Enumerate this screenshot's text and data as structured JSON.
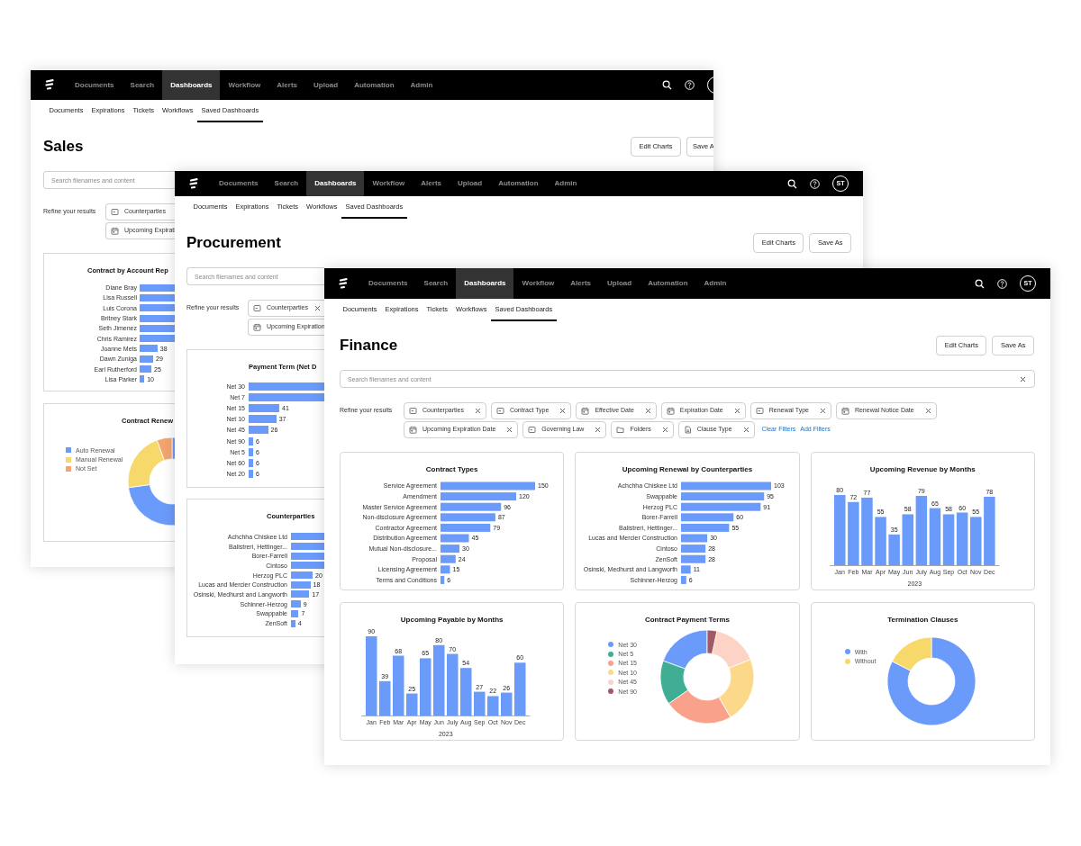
{
  "windows": [
    {
      "nav": [
        {
          "label": "Documents",
          "selected": false
        },
        {
          "label": "Search",
          "selected": false
        },
        {
          "label": "Dashboards",
          "selected": true
        },
        {
          "label": "Workflow",
          "selected": false
        },
        {
          "label": "Alerts",
          "selected": false
        },
        {
          "label": "Upload",
          "selected": false
        },
        {
          "label": "Automation",
          "selected": false
        },
        {
          "label": "Admin",
          "selected": false
        }
      ],
      "subnav": [
        {
          "label": "Documents",
          "selected": false
        },
        {
          "label": "Expirations",
          "selected": false
        },
        {
          "label": "Tickets",
          "selected": false
        },
        {
          "label": "Workflows",
          "selected": false
        },
        {
          "label": "Saved Dashboards",
          "selected": true
        }
      ],
      "title": "Sales",
      "buttons": [
        "Edit Charts",
        "Save A"
      ],
      "search": {
        "placeholder": "Search filenames and content",
        "clearable": false
      },
      "refine_label": "Refine your results",
      "filters": [
        {
          "label": "Counterparties",
          "kind": "select",
          "removable": false
        },
        {
          "label": "Upcoming Expirati",
          "kind": "date",
          "removable": false
        }
      ],
      "panels": [
        {
          "kind": "bars",
          "title": "Contract by Account Rep",
          "rows": [
            {
              "label": "Diane Bray"
            },
            {
              "label": "Lisa Russell"
            },
            {
              "label": "Luis Corona"
            },
            {
              "label": "Britney Stark"
            },
            {
              "label": "Seth Jimenez"
            },
            {
              "label": "Chris Ramirez"
            },
            {
              "label": "Joanne Mets",
              "value": "38"
            },
            {
              "label": "Dawn Zuniga",
              "value": "29"
            },
            {
              "label": "Earl Rutherford",
              "value": "25"
            },
            {
              "label": "Lisa Parker",
              "value": "10"
            }
          ]
        },
        {
          "kind": "donut",
          "title": "Contract Renew",
          "legend": [
            {
              "label": "Auto Renewal",
              "color": "#6b9bfa"
            },
            {
              "label": "Manual Renewal",
              "color": "#f7d96b"
            },
            {
              "label": "Not Set",
              "color": "#f5a470"
            }
          ]
        }
      ]
    },
    {
      "nav": [
        {
          "label": "Documents",
          "selected": false
        },
        {
          "label": "Search",
          "selected": false
        },
        {
          "label": "Dashboards",
          "selected": true
        },
        {
          "label": "Workflow",
          "selected": false
        },
        {
          "label": "Alerts",
          "selected": false
        },
        {
          "label": "Upload",
          "selected": false
        },
        {
          "label": "Automation",
          "selected": false
        },
        {
          "label": "Admin",
          "selected": false
        }
      ],
      "avatar": "ST",
      "subnav": [
        {
          "label": "Documents",
          "selected": false
        },
        {
          "label": "Expirations",
          "selected": false
        },
        {
          "label": "Tickets",
          "selected": false
        },
        {
          "label": "Workflows",
          "selected": false
        },
        {
          "label": "Saved Dashboards",
          "selected": true
        }
      ],
      "title": "Procurement",
      "buttons": [
        "Edit Charts",
        "Save As"
      ],
      "search": {
        "placeholder": "Search filenames and content",
        "clearable": false
      },
      "refine_label": "Refine your results",
      "filters": [
        {
          "label": "Counterparties",
          "kind": "select",
          "removable": true
        },
        {
          "label": "Upcoming Expiration",
          "kind": "date",
          "removable": false
        }
      ],
      "panels": [
        {
          "kind": "bars",
          "title": "Payment Term (Net D",
          "rows": [
            {
              "label": "Net 30"
            },
            {
              "label": "Net 7"
            },
            {
              "label": "Net 15",
              "value": "41"
            },
            {
              "label": "Net 10",
              "value": "37"
            },
            {
              "label": "Net 45",
              "value": "26"
            },
            {
              "label": "Net 90",
              "value": "6"
            },
            {
              "label": "Net 5",
              "value": "6"
            },
            {
              "label": "Net 60",
              "value": "6"
            },
            {
              "label": "Net 20",
              "value": "6"
            }
          ]
        },
        {
          "kind": "bars",
          "title": "Counterparties",
          "rows": [
            {
              "label": "Achchha Chiskee Ltd"
            },
            {
              "label": "Balistreri, Hettinger..."
            },
            {
              "label": "Borer-Farrell"
            },
            {
              "label": "Cintoso"
            },
            {
              "label": "Herzog PLC",
              "value": "20"
            },
            {
              "label": "Lucas and Mercier Construction",
              "value": "18"
            },
            {
              "label": "Osinski, Medhurst and Langworth",
              "value": "17"
            },
            {
              "label": "Schinner-Herzog",
              "value": "9"
            },
            {
              "label": "Swappable",
              "value": "7"
            },
            {
              "label": "ZenSoft",
              "value": "4"
            }
          ]
        }
      ]
    },
    {
      "nav": [
        {
          "label": "Documents",
          "selected": false
        },
        {
          "label": "Search",
          "selected": false
        },
        {
          "label": "Dashboards",
          "selected": true
        },
        {
          "label": "Workflow",
          "selected": false
        },
        {
          "label": "Alerts",
          "selected": false
        },
        {
          "label": "Upload",
          "selected": false
        },
        {
          "label": "Automation",
          "selected": false
        },
        {
          "label": "Admin",
          "selected": false
        }
      ],
      "avatar": "ST",
      "subnav": [
        {
          "label": "Documents",
          "selected": false
        },
        {
          "label": "Expirations",
          "selected": false
        },
        {
          "label": "Tickets",
          "selected": false
        },
        {
          "label": "Workflows",
          "selected": false
        },
        {
          "label": "Saved Dashboards",
          "selected": true
        }
      ],
      "title": "Finance",
      "buttons": [
        "Edit Charts",
        "Save As"
      ],
      "search": {
        "placeholder": "Search filenames and content",
        "clearable": true
      },
      "refine_label": "Refine your results",
      "filters": [
        {
          "label": "Counterparties",
          "kind": "select",
          "removable": true
        },
        {
          "label": "Contract Type",
          "kind": "select",
          "removable": true
        },
        {
          "label": "Effective Date",
          "kind": "date",
          "removable": true
        },
        {
          "label": "Expiration Date",
          "kind": "date",
          "removable": true
        },
        {
          "label": "Renewal Type",
          "kind": "select",
          "removable": true
        },
        {
          "label": "Renewal Notice Date",
          "kind": "date",
          "removable": true
        },
        {
          "label": "Upcoming Expiration Date",
          "kind": "date",
          "removable": true
        },
        {
          "label": "Governing Law",
          "kind": "select",
          "removable": true
        },
        {
          "label": "Folders",
          "kind": "folder",
          "removable": true
        },
        {
          "label": "Clause Type",
          "kind": "file",
          "removable": true
        }
      ],
      "links": [
        "Clear Filters",
        "Add Filters"
      ],
      "panels": [
        {
          "kind": "chart",
          "title": "Contract Types",
          "chart_data": {
            "type": "bar",
            "orientation": "horizontal",
            "categories": [
              "Service Agreement",
              "Amendment",
              "Master Service Agreement",
              "Non-disclosure Agreement",
              "Contractor Agreement",
              "Distribution Agreement",
              "Mutual Non-disclosure...",
              "Proposal",
              "Licensing Agreement",
              "Terms and Conditions"
            ],
            "values": [
              150,
              120,
              96,
              87,
              79,
              45,
              30,
              24,
              15,
              6
            ],
            "data_labels": true
          }
        },
        {
          "kind": "chart",
          "title": "Upcoming Renewal by Counterparties",
          "chart_data": {
            "type": "bar",
            "orientation": "horizontal",
            "categories": [
              "Achchha Chiskee Ltd",
              "Swappable",
              "Herzog PLC",
              "Borer-Farrell",
              "Balistreri, Hettinger...",
              "Lucas and Mercier Construction",
              "Cintoso",
              "ZenSoft",
              "Osinski, Medhurst and Langworth",
              "Schinner-Herzog"
            ],
            "values": [
              103,
              95,
              91,
              60,
              55,
              30,
              28,
              28,
              11,
              6
            ],
            "data_labels": true
          }
        },
        {
          "kind": "chart",
          "title": "Upcoming Revenue by Months",
          "chart_data": {
            "type": "bar",
            "orientation": "vertical",
            "xlabel": "2023",
            "categories": [
              "Jan",
              "Feb",
              "Mar",
              "Apr",
              "May",
              "Jun",
              "July",
              "Aug",
              "Sep",
              "Oct",
              "Nov",
              "Dec"
            ],
            "values": [
              80,
              72,
              77,
              55,
              35,
              58,
              79,
              65,
              58,
              60,
              55,
              78
            ],
            "data_labels": true
          }
        },
        {
          "kind": "chart",
          "title": "Upcoming Payable by Months",
          "chart_data": {
            "type": "bar",
            "orientation": "vertical",
            "xlabel": "2023",
            "categories": [
              "Jan",
              "Feb",
              "Mar",
              "Apr",
              "May",
              "Jun",
              "July",
              "Aug",
              "Sep",
              "Oct",
              "Nov",
              "Dec"
            ],
            "values": [
              90,
              39,
              68,
              25,
              65,
              80,
              70,
              54,
              27,
              22,
              26,
              60
            ],
            "data_labels": true
          }
        },
        {
          "kind": "donut",
          "title": "Contract Payment Terms",
          "legend": [
            {
              "label": "Net 30",
              "color": "#6b9bfa"
            },
            {
              "label": "Net 5",
              "color": "#3fae94"
            },
            {
              "label": "Net 15",
              "color": "#f9a18b"
            },
            {
              "label": "Net 10",
              "color": "#fcd98a"
            },
            {
              "label": "Net 45",
              "color": "#fdd3c5"
            },
            {
              "label": "Net 90",
              "color": "#a05a66"
            }
          ]
        },
        {
          "kind": "donut",
          "title": "Termination Clauses",
          "legend": [
            {
              "label": "With",
              "color": "#6b9bfa"
            },
            {
              "label": "Without",
              "color": "#f7d96b"
            }
          ]
        }
      ]
    }
  ]
}
